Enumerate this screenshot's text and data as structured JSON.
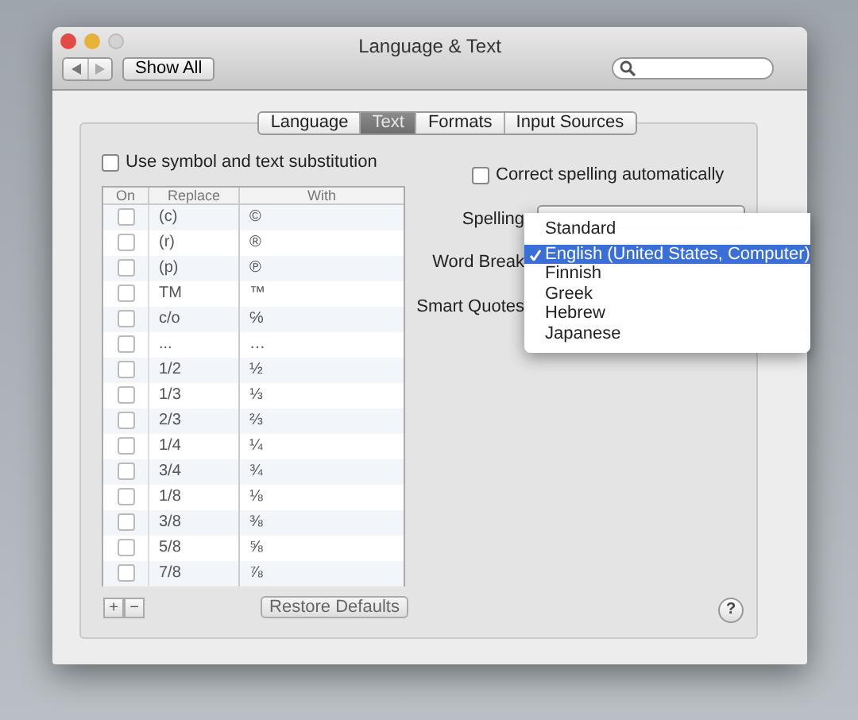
{
  "window": {
    "title": "Language & Text"
  },
  "toolbar": {
    "show_all": "Show All"
  },
  "tabs": [
    {
      "label": "Language",
      "selected": false
    },
    {
      "label": "Text",
      "selected": true
    },
    {
      "label": "Formats",
      "selected": false
    },
    {
      "label": "Input Sources",
      "selected": false
    }
  ],
  "substitution": {
    "label": "Use symbol and text substitution",
    "checked": false,
    "columns": [
      "On",
      "Replace",
      "With"
    ],
    "rows": [
      {
        "on": false,
        "replace": "(c)",
        "with": "©"
      },
      {
        "on": false,
        "replace": "(r)",
        "with": "®"
      },
      {
        "on": false,
        "replace": "(p)",
        "with": "℗"
      },
      {
        "on": false,
        "replace": "TM",
        "with": "™"
      },
      {
        "on": false,
        "replace": "c/o",
        "with": "℅"
      },
      {
        "on": false,
        "replace": "...",
        "with": "…"
      },
      {
        "on": false,
        "replace": "1/2",
        "with": "½"
      },
      {
        "on": false,
        "replace": "1/3",
        "with": "⅓"
      },
      {
        "on": false,
        "replace": "2/3",
        "with": "⅔"
      },
      {
        "on": false,
        "replace": "1/4",
        "with": "¼"
      },
      {
        "on": false,
        "replace": "3/4",
        "with": "¾"
      },
      {
        "on": false,
        "replace": "1/8",
        "with": "⅛"
      },
      {
        "on": false,
        "replace": "3/8",
        "with": "⅜"
      },
      {
        "on": false,
        "replace": "5/8",
        "with": "⅝"
      },
      {
        "on": false,
        "replace": "7/8",
        "with": "⅞"
      }
    ],
    "add": "+",
    "remove": "−",
    "restore": "Restore Defaults"
  },
  "help": "?",
  "spelling_correction": {
    "label": "Correct spelling automatically",
    "checked": false
  },
  "fields": [
    {
      "label": "Spelling"
    },
    {
      "label": "Word Break"
    },
    {
      "label": "Smart Quotes"
    }
  ],
  "menu": {
    "items": [
      {
        "label": "Standard",
        "selected": false
      },
      {
        "label": "English (United States, Computer)",
        "selected": true
      },
      {
        "label": "Finnish",
        "selected": false
      },
      {
        "label": "Greek",
        "selected": false
      },
      {
        "label": "Hebrew",
        "selected": false
      },
      {
        "label": "Japanese",
        "selected": false
      }
    ]
  }
}
